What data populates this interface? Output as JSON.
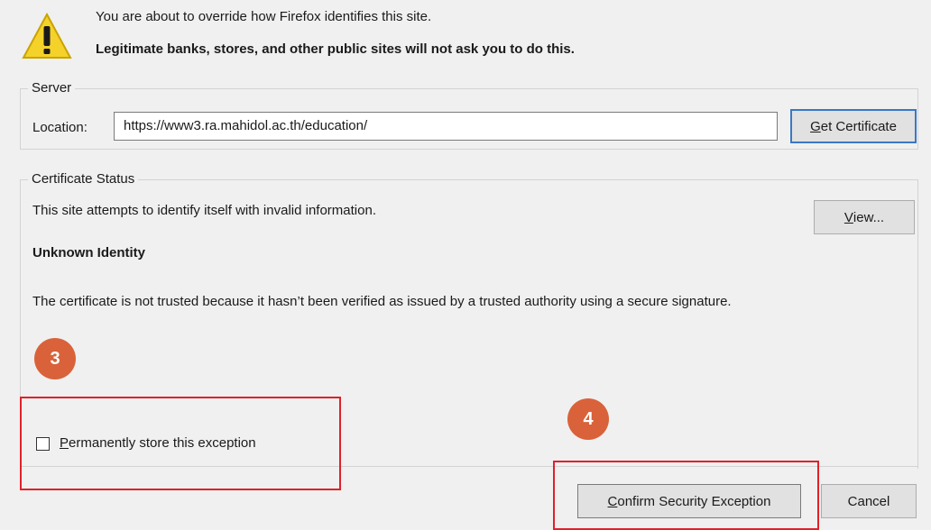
{
  "header": {
    "line1": "You are about to override how Firefox identifies this site.",
    "line2": "Legitimate banks, stores, and other public sites will not ask you to do this.",
    "icon": "warning-icon"
  },
  "server": {
    "group_label": "Server",
    "location_label": "Location:",
    "location_value": "https://www3.ra.mahidol.ac.th/education/",
    "get_certificate": {
      "mnemonic": "G",
      "rest": "et Certificate"
    }
  },
  "status": {
    "group_label": "Certificate Status",
    "text": "This site attempts to identify itself with invalid information.",
    "view_button": {
      "mnemonic": "V",
      "rest": "iew..."
    },
    "identity_title": "Unknown Identity",
    "description": "The certificate is not trusted because it hasn’t been verified as issued by a trusted authority using a secure signature."
  },
  "footer": {
    "permanent": {
      "mnemonic": "P",
      "rest": "ermanently store this exception",
      "checked": false
    },
    "confirm_button": {
      "mnemonic": "C",
      "rest": "onfirm Security Exception"
    },
    "cancel_button": "Cancel"
  },
  "annotations": {
    "step3": "3",
    "step4": "4",
    "highlight_color": "#e0212a",
    "badge_color": "#d9623a"
  }
}
